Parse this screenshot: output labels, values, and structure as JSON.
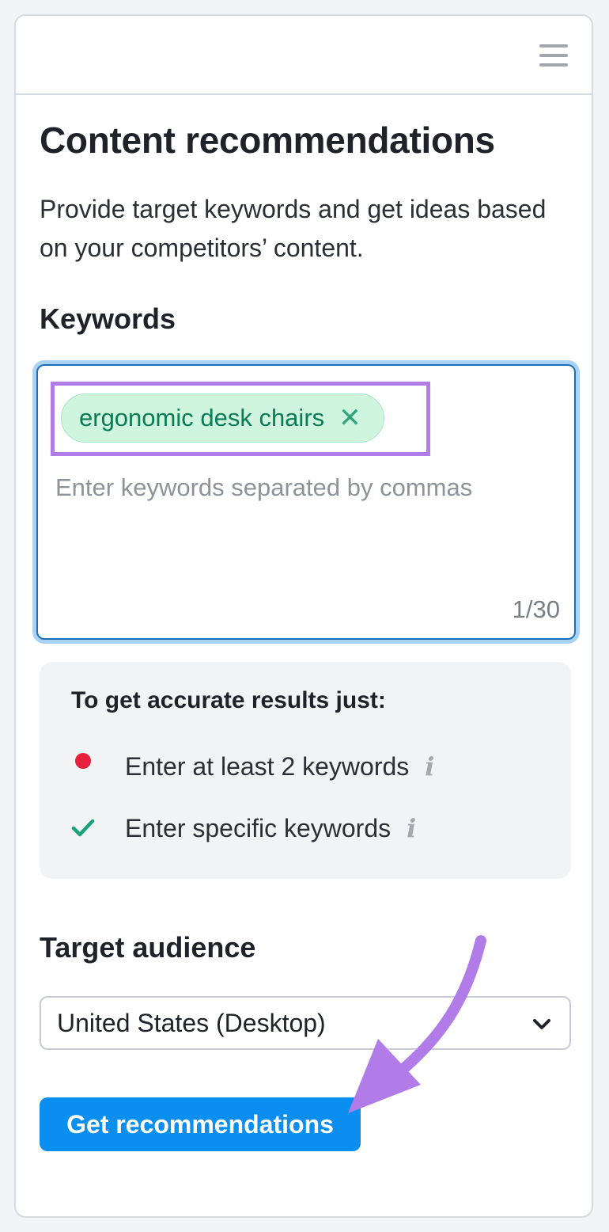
{
  "header": {
    "menu_icon": "hamburger-menu-icon"
  },
  "main": {
    "title": "Content recommendations",
    "description": "Provide target keywords and get ideas based on your competitors’ content."
  },
  "keywords": {
    "label": "Keywords",
    "chips": [
      {
        "text": "ergonomic desk chairs",
        "remove_icon": "close-icon",
        "remove_glyph": "✕"
      }
    ],
    "input_value": "",
    "placeholder": "Enter keywords separated by commas",
    "counter": "1/30"
  },
  "tips": {
    "title": "To get accurate results just:",
    "items": [
      {
        "text": "Enter at least 2 keywords",
        "status": "unmet",
        "status_icon": "red-dot-icon",
        "info_glyph": "i"
      },
      {
        "text": "Enter specific keywords",
        "status": "met",
        "status_icon": "checkmark-icon",
        "info_glyph": "i"
      }
    ]
  },
  "audience": {
    "label": "Target audience",
    "selected": "United States (Desktop)"
  },
  "actions": {
    "submit_label": "Get recommendations"
  },
  "colors": {
    "accent": "#0a8ef0",
    "chip_bg": "#cff5df",
    "chip_text": "#0b7a56",
    "highlight": "#b27ce8",
    "error": "#e5213d",
    "success": "#16a37b"
  }
}
